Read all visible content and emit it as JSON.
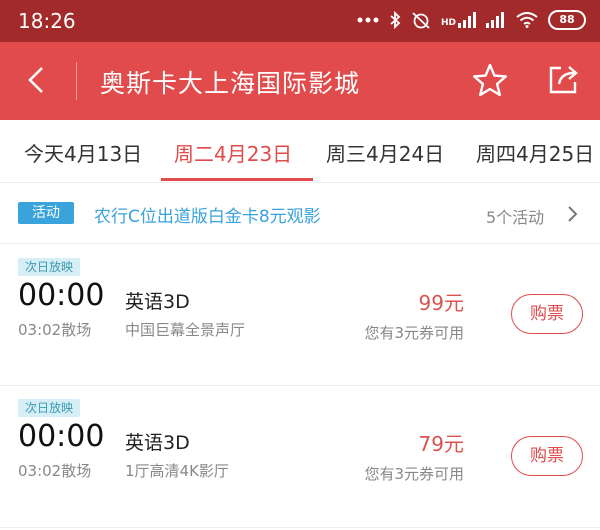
{
  "status_bar": {
    "time": "18:26",
    "signal_label": "HD",
    "battery": "88"
  },
  "header": {
    "title": "奥斯卡大上海国际影城"
  },
  "tabs": [
    {
      "label": "今天4月13日"
    },
    {
      "label": "周二4月23日"
    },
    {
      "label": "周三4月24日"
    },
    {
      "label": "周四4月25日"
    }
  ],
  "active_tab": 1,
  "promo": {
    "badge": "活动",
    "text": "农行C位出道版白金卡8元观影",
    "count": "5个活动"
  },
  "showtimes": [
    {
      "tag": "次日放映",
      "start": "00:00",
      "end": "03:02散场",
      "language": "英语3D",
      "hall": "中国巨幕全景声厅",
      "price": "99元",
      "coupon": "您有3元券可用",
      "buy_label": "购票"
    },
    {
      "tag": "次日放映",
      "start": "00:00",
      "end": "03:02散场",
      "language": "英语3D",
      "hall": "1厅高清4K影厅",
      "price": "79元",
      "coupon": "您有3元券可用",
      "buy_label": "购票"
    }
  ],
  "colors": {
    "status_bar": "#a32a2a",
    "header": "#e14b4b",
    "accent": "#e14b4b",
    "promo_blue": "#3aa3dc"
  }
}
